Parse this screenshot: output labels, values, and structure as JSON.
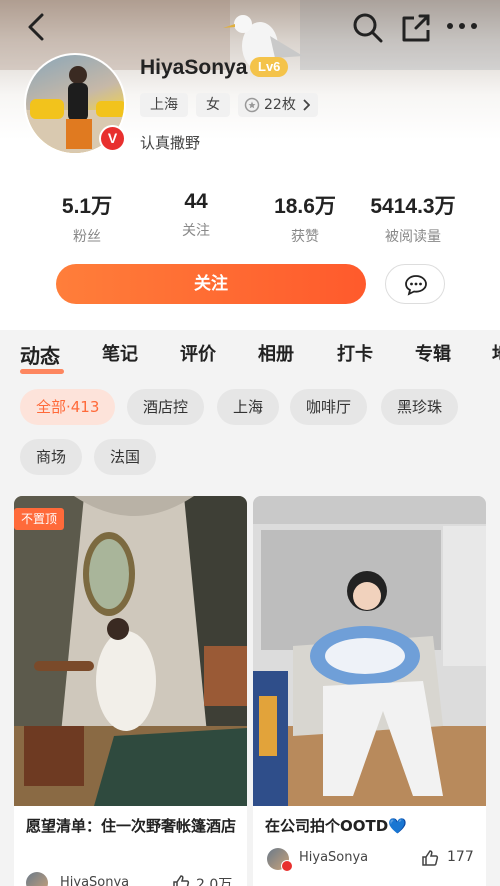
{
  "profile": {
    "username": "HiyaSonya",
    "level": "Lv6",
    "tags": [
      "上海",
      "女",
      "22枚"
    ],
    "bio": "认真撒野"
  },
  "stats": [
    {
      "value": "5.1万",
      "label": "粉丝"
    },
    {
      "value": "44",
      "label": "关注"
    },
    {
      "value": "18.6万",
      "label": "获赞"
    },
    {
      "value": "5414.3万",
      "label": "被阅读量"
    }
  ],
  "actions": {
    "follow_label": "关注"
  },
  "tabs": [
    "动态",
    "笔记",
    "评价",
    "相册",
    "打卡",
    "专辑",
    "地"
  ],
  "chips": [
    "全部·413",
    "酒店控",
    "上海",
    "咖啡厅",
    "黑珍珠",
    "商场",
    "法国"
  ],
  "posts": [
    {
      "badge": "不置顶",
      "title": "愿望清单：住一次野奢帐篷酒店",
      "author": "HiyaSonya",
      "likes": "2.0万"
    },
    {
      "title": "在公司拍个OOTD💙",
      "author": "HiyaSonya",
      "likes": "177"
    }
  ],
  "colors": {
    "accent": "#ff6a3a",
    "level_badge": "#f4c34a",
    "verified": "#e8302e"
  },
  "icons": [
    "back-icon",
    "search-icon",
    "share-icon",
    "more-icon",
    "medal-icon",
    "chevron-right-icon",
    "message-icon",
    "like-icon",
    "verified-icon"
  ]
}
